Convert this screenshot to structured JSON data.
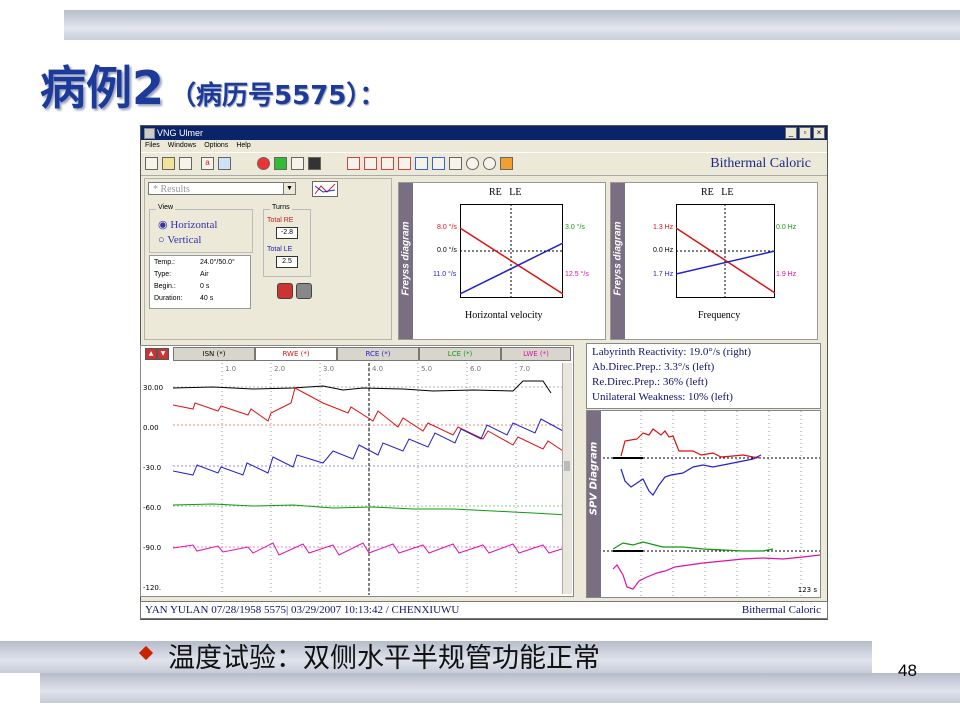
{
  "slide": {
    "title_main": "病例2",
    "title_sub": "（病历号5575）：",
    "caption": "温度试验：双侧水平半规管功能正常",
    "page_number": "48"
  },
  "app": {
    "title": "VNG Ulmer",
    "window_buttons": [
      "_",
      "▫",
      "×"
    ],
    "menu": [
      "Files",
      "Windows",
      "Options",
      "Help"
    ],
    "toolbar_label": "Bithermal Caloric",
    "results_select": "* Results",
    "view": {
      "legend": "View",
      "options": [
        "Horizontal",
        "Vertical"
      ],
      "selected": "Horizontal"
    },
    "turns": {
      "legend": "Turns",
      "re_label": "Total RE",
      "re_value": "-2.8",
      "le_label": "Total LE",
      "le_value": "2.5"
    },
    "info": [
      {
        "label": "Temp.:",
        "value": "24.0°/50.0°"
      },
      {
        "label": "Type:",
        "value": "Air"
      },
      {
        "label": "Begin.:",
        "value": "0 s"
      },
      {
        "label": "Duration:",
        "value": "40 s"
      }
    ]
  },
  "freyss_velocity": {
    "side_label": "Freyss diagram",
    "re": "RE",
    "le": "LE",
    "left_labels": [
      "8.0 °/s",
      "0.0 °/s",
      "11.0 °/s"
    ],
    "right_labels": [
      "3.0 °/s",
      "12.5 °/s"
    ],
    "xlabel": "Horizontal velocity",
    "colors": {
      "re": "#dd1111",
      "le": "#2222cc"
    }
  },
  "freyss_frequency": {
    "side_label": "Freyss diagram",
    "re": "RE",
    "le": "LE",
    "left_labels": [
      "1.3 Hz",
      "0.0 Hz",
      "1.7 Hz"
    ],
    "right_labels": [
      "0.0 Hz",
      "1.9 Hz"
    ],
    "xlabel": "Frequency"
  },
  "channels": {
    "headers": [
      "ISN (*)",
      "RWE (*)",
      "RCE (*)",
      "LCE (*)",
      "LWE (*)"
    ],
    "header_colors": [
      "#000000",
      "#dd1111",
      "#2222cc",
      "#119911",
      "#dd11aa"
    ],
    "y_labels": [
      "30.00",
      "0.00",
      "-30.0",
      "-60.0",
      "-90.0",
      "-120."
    ],
    "x_labels": [
      "1.0",
      "2.0",
      "3.0",
      "4.0",
      "5.0",
      "6.0",
      "7.0"
    ]
  },
  "results": {
    "lines": [
      "Labyrinth Reactivity: 19.0°/s (right)",
      "Ab.Direc.Prep.: 3.3°/s (left)",
      "Re.Direc.Prep.: 36% (left)",
      "Unilateral Weakness: 10% (left)"
    ]
  },
  "spv": {
    "side_label": "SPV Diagram",
    "time_label": "123 s"
  },
  "status": {
    "left": "YAN YULAN  07/28/1958  5575| 03/29/2007 10:13:42  / CHENXIUWU",
    "right": "Bithermal Caloric"
  }
}
